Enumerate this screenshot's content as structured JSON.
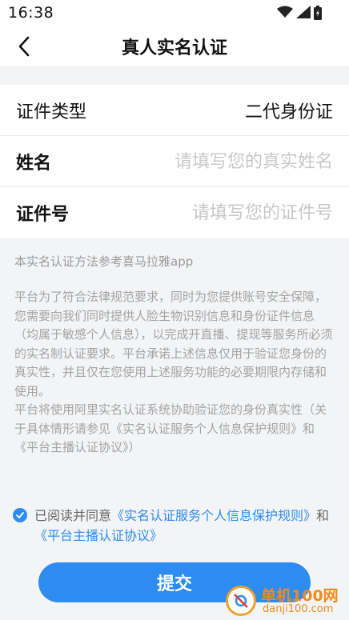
{
  "status_bar": {
    "time": "16:38",
    "icons": [
      "wifi-icon",
      "signal-icon",
      "battery-icon"
    ]
  },
  "nav": {
    "title": "真人实名认证",
    "back_icon": "chevron-left-icon"
  },
  "form": {
    "type_label": "证件类型",
    "type_value": "二代身份证",
    "name_label": "姓名",
    "name_placeholder": "请填写您的真实姓名",
    "name_value": "",
    "id_label": "证件号",
    "id_placeholder": "请填写您的证件号",
    "id_value": ""
  },
  "method_note": "本实名认证方法参考喜马拉雅app",
  "policy_text": "平台为了符合法律规范要求，同时为您提供账号安全保障，您需要向我们同时提供人脸生物识别信息和身份证件信息（均属于敏感个人信息），以完成开直播、提现等服务所必须的实名制认证要求。平台承诺上述信息仅用于验证您身份的真实性，并且仅在您使用上述服务功能的必要期限内存储和使用。\n平台将使用阿里实名认证系统协助验证您的身份真实性（关于具体情形请参见《实名认证服务个人信息保护规则》和《平台主播认证协议》）",
  "agreement": {
    "checked": true,
    "prefix": "已阅读并同意",
    "link1": "《实名认证服务个人信息保护规则》",
    "connector": "和",
    "link2": "《平台主播认证协议》"
  },
  "submit_label": "提交",
  "watermark": {
    "text_main": "单机100网",
    "text_url": "danji100.com"
  },
  "colors": {
    "accent": "#2d8cf0",
    "page_bg": "#f3f4f6",
    "watermark": "#f08a1c"
  }
}
